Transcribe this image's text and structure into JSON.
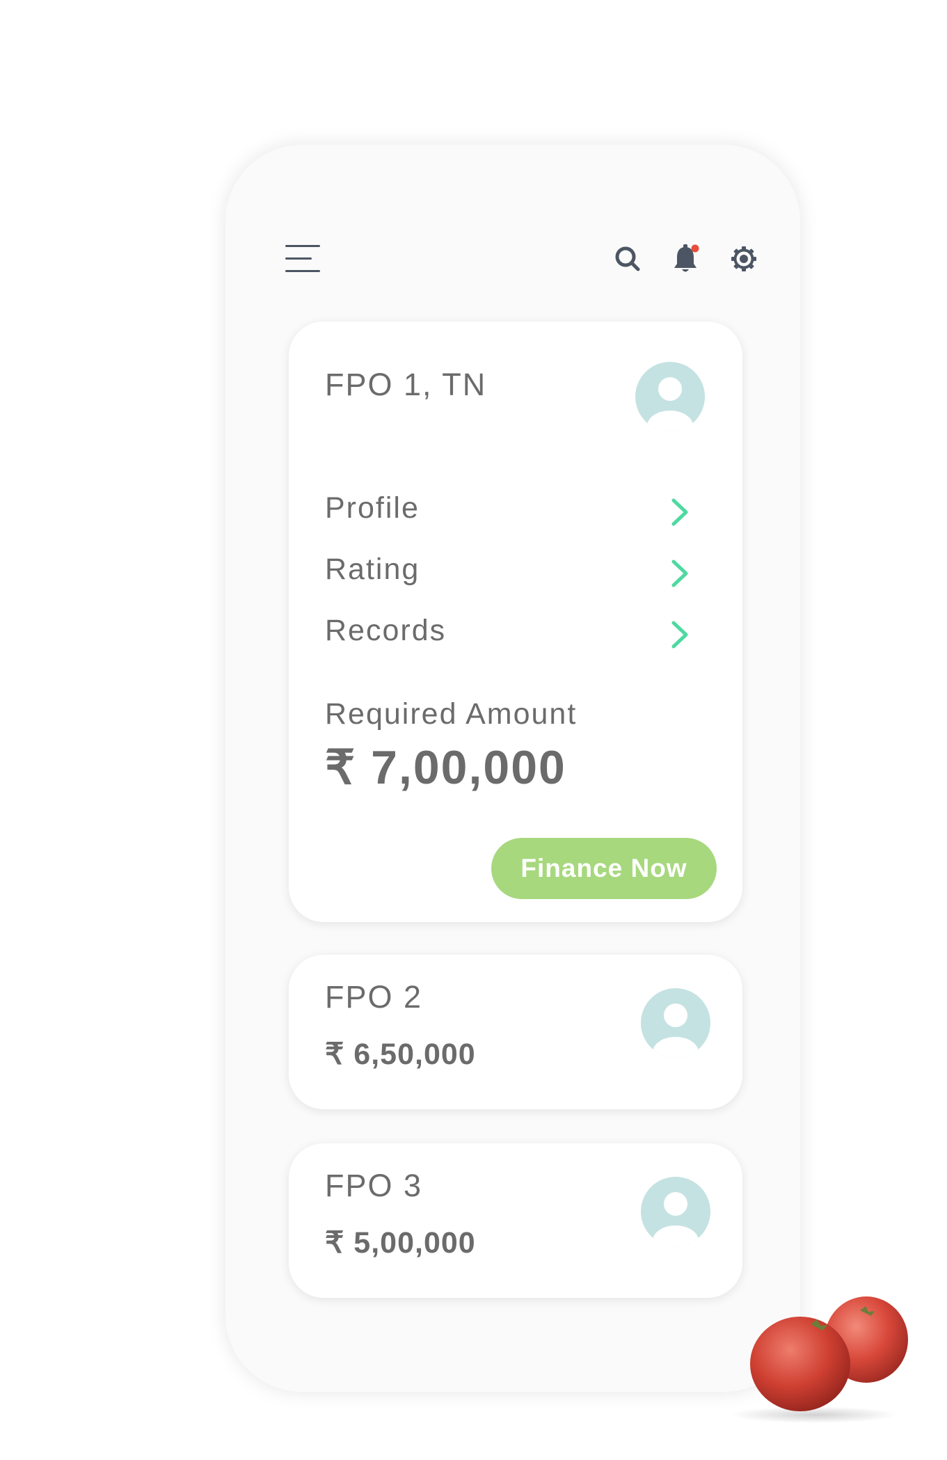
{
  "topbar": {
    "icons": [
      "menu-icon",
      "search-icon",
      "bell-icon",
      "gear-icon"
    ],
    "notification_dot_color": "#e74c3c"
  },
  "cards": {
    "main": {
      "title": "FPO 1, TN",
      "menu": [
        {
          "label": "Profile"
        },
        {
          "label": "Rating"
        },
        {
          "label": "Records"
        }
      ],
      "required_label": "Required Amount",
      "required_amount": "₹ 7,00,000",
      "cta_label": "Finance Now"
    },
    "fpo2": {
      "title": "FPO 2",
      "amount": "₹ 6,50,000"
    },
    "fpo3": {
      "title": "FPO 3",
      "amount": "₹ 5,00,000"
    }
  },
  "colors": {
    "accent_green": "#a7d87e",
    "chevron_green": "#4ed9a0",
    "avatar_teal": "#c4e2e2",
    "text_gray": "#6b6b6b",
    "icon_dark": "#4c5563"
  }
}
